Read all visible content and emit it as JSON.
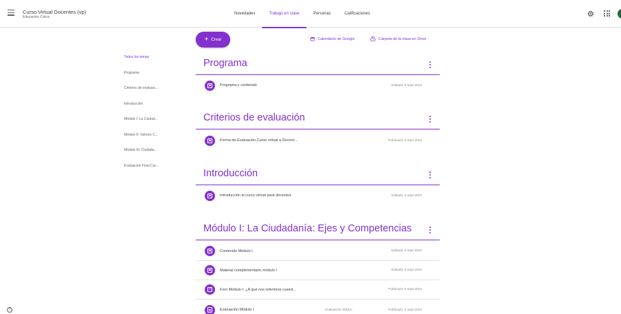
{
  "course": {
    "title": "Curso Virtual Docentes (vp)",
    "subtitle": "Educación Cívica"
  },
  "tabs": [
    {
      "label": "Novedades"
    },
    {
      "label": "Trabajo en clase"
    },
    {
      "label": "Personas"
    },
    {
      "label": "Calificaciones"
    }
  ],
  "active_tab": "Trabajo en clase",
  "toolbar": {
    "create_label": "Crear",
    "calendar_label": "Calendario de Google",
    "drive_label": "Carpeta de la clase en Drive"
  },
  "topics": [
    "Todos los temas",
    "Programa",
    "Criterios de evaluaci...",
    "Introducción",
    "Módulo I: La Ciudad...",
    "Módulo II: Valores C...",
    "Módulo III: Ciudada...",
    "Evaluación Final Cur..."
  ],
  "sections": [
    {
      "title": "Programa",
      "items": [
        {
          "title": "Programa y contenido",
          "date": "Editado: 6 sept 2022",
          "icon": "material-icon"
        }
      ]
    },
    {
      "title": "Criterios de evaluación",
      "items": [
        {
          "title": "Forma de Evaluación Curso virtual a Docent...",
          "date": "Publicado: 5 sept 2022",
          "icon": "material-icon"
        }
      ]
    },
    {
      "title": "Introducción",
      "items": [
        {
          "title": "Introducción al curso virtual para docentes",
          "date": "Editado: 6 sept 2022",
          "icon": "material-icon"
        }
      ]
    },
    {
      "title": "Módulo I: La Ciudadanía: Ejes y Competencias",
      "items": [
        {
          "title": "Contenido Módulo I",
          "date": "Editado: 6 sept 2022",
          "icon": "material-icon"
        },
        {
          "title": "Material complementario módulo I",
          "date": "Editado: 5 sept 2022",
          "icon": "material-icon"
        },
        {
          "title": "Foro Módulo I. ¿A qué nos referimos cuand...",
          "date": "Publicado: 5 sept 2022",
          "icon": "question-icon"
        },
        {
          "title": "Evaluación Módulo I",
          "extra": "Evaluación Módul...",
          "date": "Publicado: 5 sept 2022",
          "icon": "assignment-icon"
        }
      ]
    }
  ],
  "colors": {
    "accent": "#8430ce",
    "avatar": "#1e6b3a",
    "text": "#3c4043",
    "muted": "#80868b"
  },
  "help_label": "?"
}
